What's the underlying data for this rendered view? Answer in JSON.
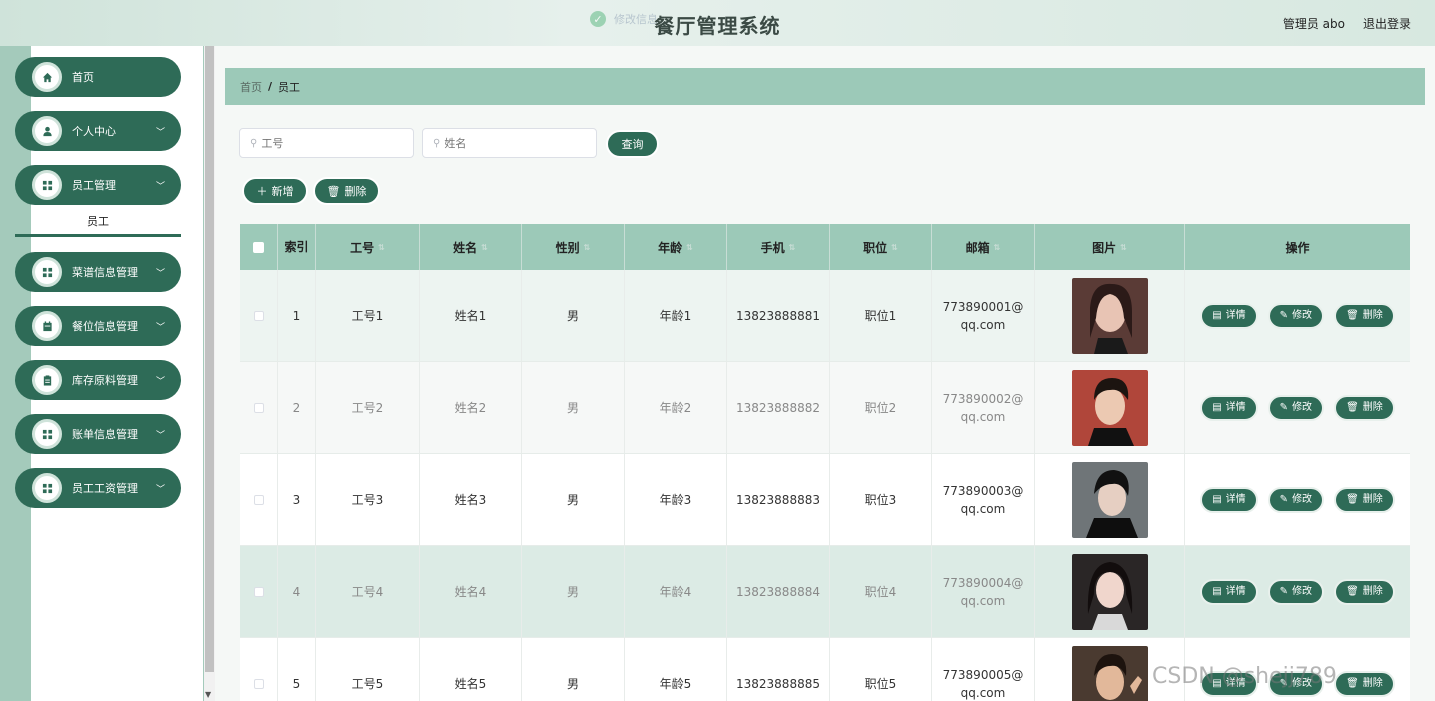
{
  "header": {
    "toast": "修改信息",
    "title": "餐厅管理系统",
    "user": "管理员 abo",
    "logout": "退出登录"
  },
  "sidebar": {
    "items": [
      {
        "label": "首页",
        "icon": "home-icon",
        "has_chevron": false
      },
      {
        "label": "个人中心",
        "icon": "user-icon",
        "has_chevron": true
      },
      {
        "label": "员工管理",
        "icon": "grid-icon",
        "has_chevron": true
      },
      {
        "label": "菜谱信息管理",
        "icon": "grid-icon",
        "has_chevron": true
      },
      {
        "label": "餐位信息管理",
        "icon": "calendar-icon",
        "has_chevron": true
      },
      {
        "label": "库存原料管理",
        "icon": "clipboard-icon",
        "has_chevron": true
      },
      {
        "label": "账单信息管理",
        "icon": "grid-icon",
        "has_chevron": true
      },
      {
        "label": "员工工资管理",
        "icon": "grid-icon",
        "has_chevron": true
      }
    ],
    "active_sub": "员工"
  },
  "breadcrumb": {
    "home": "首页",
    "separator": "/",
    "current": "员工"
  },
  "search": {
    "employee_no_placeholder": "工号",
    "name_placeholder": "姓名",
    "query_label": "查询"
  },
  "toolbar": {
    "add_label": "新增",
    "delete_label": "删除"
  },
  "table": {
    "headers": [
      "索引",
      "工号",
      "姓名",
      "性别",
      "年龄",
      "手机",
      "职位",
      "邮箱",
      "图片",
      "操作"
    ],
    "rows": [
      {
        "index": "1",
        "emp_no": "工号1",
        "name": "姓名1",
        "gender": "男",
        "age": "年龄1",
        "phone": "13823888881",
        "position": "职位1",
        "email": "773890001@qq.com"
      },
      {
        "index": "2",
        "emp_no": "工号2",
        "name": "姓名2",
        "gender": "男",
        "age": "年龄2",
        "phone": "13823888882",
        "position": "职位2",
        "email": "773890002@qq.com"
      },
      {
        "index": "3",
        "emp_no": "工号3",
        "name": "姓名3",
        "gender": "男",
        "age": "年龄3",
        "phone": "13823888883",
        "position": "职位3",
        "email": "773890003@qq.com"
      },
      {
        "index": "4",
        "emp_no": "工号4",
        "name": "姓名4",
        "gender": "男",
        "age": "年龄4",
        "phone": "13823888884",
        "position": "职位4",
        "email": "773890004@qq.com"
      },
      {
        "index": "5",
        "emp_no": "工号5",
        "name": "姓名5",
        "gender": "男",
        "age": "年龄5",
        "phone": "13823888885",
        "position": "职位5",
        "email": "773890005@qq.com"
      }
    ],
    "actions": {
      "detail": "详情",
      "edit": "修改",
      "delete": "删除"
    }
  },
  "watermark": "CSDN @shejj789",
  "colors": {
    "primary": "#2e6b57",
    "accent": "#9cc9b8",
    "sidebar_bg": "#a4cabb"
  }
}
